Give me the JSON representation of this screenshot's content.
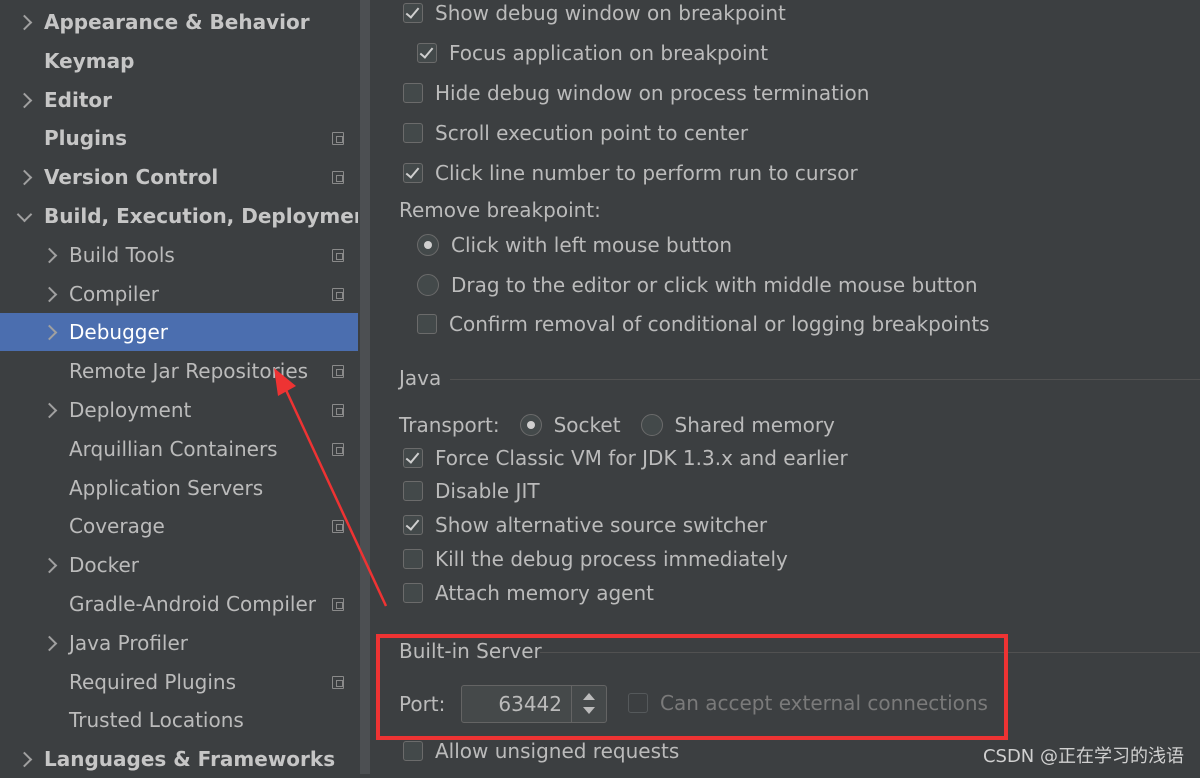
{
  "sidebar": {
    "items": [
      {
        "label": "Appearance & Behavior",
        "bold": true,
        "expandable": true,
        "expanded": false,
        "level": 0,
        "project": false
      },
      {
        "label": "Keymap",
        "bold": true,
        "expandable": false,
        "level": 0,
        "project": false
      },
      {
        "label": "Editor",
        "bold": true,
        "expandable": true,
        "expanded": false,
        "level": 0,
        "project": false
      },
      {
        "label": "Plugins",
        "bold": true,
        "expandable": false,
        "level": 0,
        "project": true
      },
      {
        "label": "Version Control",
        "bold": true,
        "expandable": true,
        "expanded": false,
        "level": 0,
        "project": true
      },
      {
        "label": "Build, Execution, Deployment",
        "bold": true,
        "expandable": true,
        "expanded": true,
        "level": 0,
        "project": false
      },
      {
        "label": "Build Tools",
        "bold": false,
        "expandable": true,
        "expanded": false,
        "level": 1,
        "project": true
      },
      {
        "label": "Compiler",
        "bold": false,
        "expandable": true,
        "expanded": false,
        "level": 1,
        "project": true
      },
      {
        "label": "Debugger",
        "bold": false,
        "expandable": true,
        "expanded": false,
        "level": 1,
        "project": false,
        "selected": true
      },
      {
        "label": "Remote Jar Repositories",
        "bold": false,
        "expandable": false,
        "level": 1,
        "project": true
      },
      {
        "label": "Deployment",
        "bold": false,
        "expandable": true,
        "expanded": false,
        "level": 1,
        "project": true
      },
      {
        "label": "Arquillian Containers",
        "bold": false,
        "expandable": false,
        "level": 1,
        "project": true
      },
      {
        "label": "Application Servers",
        "bold": false,
        "expandable": false,
        "level": 1,
        "project": false
      },
      {
        "label": "Coverage",
        "bold": false,
        "expandable": false,
        "level": 1,
        "project": true
      },
      {
        "label": "Docker",
        "bold": false,
        "expandable": true,
        "expanded": false,
        "level": 1,
        "project": false
      },
      {
        "label": "Gradle-Android Compiler",
        "bold": false,
        "expandable": false,
        "level": 1,
        "project": true
      },
      {
        "label": "Java Profiler",
        "bold": false,
        "expandable": true,
        "expanded": false,
        "level": 1,
        "project": false
      },
      {
        "label": "Required Plugins",
        "bold": false,
        "expandable": false,
        "level": 1,
        "project": true
      },
      {
        "label": "Trusted Locations",
        "bold": false,
        "expandable": false,
        "level": 1,
        "project": false
      },
      {
        "label": "Languages & Frameworks",
        "bold": true,
        "expandable": true,
        "expanded": false,
        "level": 0,
        "project": false
      }
    ]
  },
  "debugger": {
    "show_debug_window": {
      "label": "Show debug window on breakpoint",
      "checked": true
    },
    "focus_application": {
      "label": "Focus application on breakpoint",
      "checked": true
    },
    "hide_debug_window": {
      "label": "Hide debug window on process termination",
      "checked": false
    },
    "scroll_execution": {
      "label": "Scroll execution point to center",
      "checked": false
    },
    "click_line_number": {
      "label": "Click line number to perform run to cursor",
      "checked": true
    },
    "remove_breakpoint_title": "Remove breakpoint:",
    "remove_left_click": {
      "label": "Click with left mouse button",
      "checked": true
    },
    "remove_drag": {
      "label": "Drag to the editor or click with middle mouse button",
      "checked": false
    },
    "confirm_removal": {
      "label": "Confirm removal of conditional or logging breakpoints",
      "checked": false
    }
  },
  "java": {
    "title": "Java",
    "transport_label": "Transport:",
    "transport_socket": {
      "label": "Socket",
      "checked": true
    },
    "transport_shared": {
      "label": "Shared memory",
      "checked": false
    },
    "force_classic": {
      "label": "Force Classic VM for JDK 1.3.x and earlier",
      "checked": true
    },
    "disable_jit": {
      "label": "Disable JIT",
      "checked": false
    },
    "show_alt_source": {
      "label": "Show alternative source switcher",
      "checked": true
    },
    "kill_process": {
      "label": "Kill the debug process immediately",
      "checked": false
    },
    "attach_memory": {
      "label": "Attach memory agent",
      "checked": false
    }
  },
  "server": {
    "title": "Built-in Server",
    "port_label": "Port:",
    "port_value": "63442",
    "external_connections": {
      "label": "Can accept external connections",
      "checked": false
    },
    "allow_unsigned": {
      "label": "Allow unsigned requests",
      "checked": false
    }
  },
  "watermark": "CSDN @正在学习的浅语",
  "colors": {
    "selection": "#4b6eaf",
    "annotation": "#ee3333",
    "background": "#3c3f41"
  }
}
